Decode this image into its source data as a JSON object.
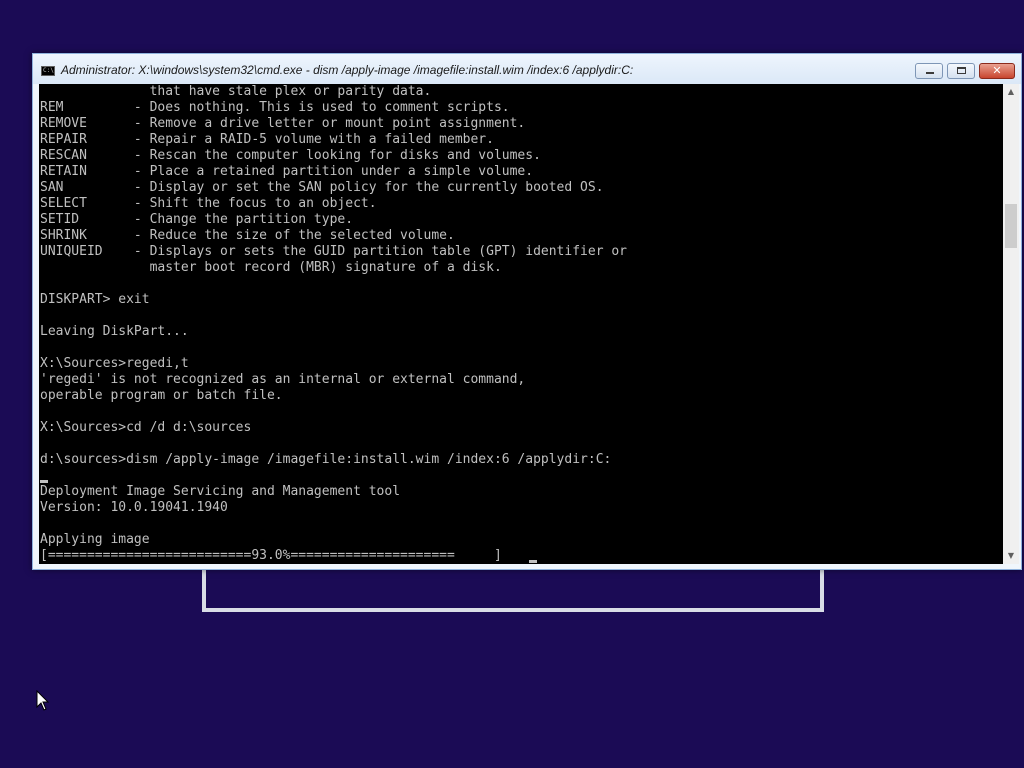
{
  "window": {
    "title": "Administrator: X:\\windows\\system32\\cmd.exe - dism  /apply-image /imagefile:install.wim /index:6 /applydir:C:",
    "icon_label": "C:\\",
    "close_glyph": "✕"
  },
  "console": {
    "lines": [
      "              that have stale plex or parity data.",
      "REM         - Does nothing. This is used to comment scripts.",
      "REMOVE      - Remove a drive letter or mount point assignment.",
      "REPAIR      - Repair a RAID-5 volume with a failed member.",
      "RESCAN      - Rescan the computer looking for disks and volumes.",
      "RETAIN      - Place a retained partition under a simple volume.",
      "SAN         - Display or set the SAN policy for the currently booted OS.",
      "SELECT      - Shift the focus to an object.",
      "SETID       - Change the partition type.",
      "SHRINK      - Reduce the size of the selected volume.",
      "UNIQUEID    - Displays or sets the GUID partition table (GPT) identifier or",
      "              master boot record (MBR) signature of a disk.",
      "",
      "DISKPART> exit",
      "",
      "Leaving DiskPart...",
      "",
      "X:\\Sources>regedi,t",
      "'regedi' is not recognized as an internal or external command,",
      "operable program or batch file.",
      "",
      "X:\\Sources>cd /d d:\\sources",
      "",
      "d:\\sources>dism /apply-image /imagefile:install.wim /index:6 /applydir:C:",
      "",
      "Deployment Image Servicing and Management tool",
      "Version: 10.0.19041.1940",
      "",
      "Applying image",
      "[==========================93.0%=====================     ]"
    ]
  },
  "progress": {
    "percent_text": "93.0%",
    "fraction": 0.93
  },
  "scrollbar": {
    "up_icon": "▲",
    "down_icon": "▼"
  },
  "colors": {
    "desktop": "#1b0b55",
    "console_bg": "#000000",
    "console_fg": "#c0c0c0"
  }
}
